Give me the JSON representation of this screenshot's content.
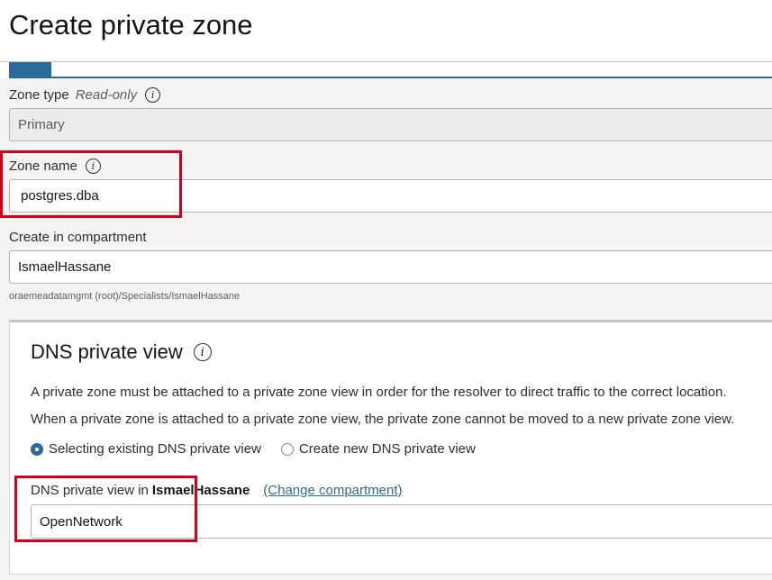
{
  "page": {
    "title": "Create private zone"
  },
  "zone_type": {
    "label": "Zone type",
    "readonly_tag": "Read-only",
    "value": "Primary"
  },
  "zone_name": {
    "label": "Zone name",
    "value": "postgres.dba"
  },
  "compartment": {
    "label": "Create in compartment",
    "value": "IsmaelHassane",
    "path": "oraemeadatamgmt (root)/Specialists/IsmaelHassane"
  },
  "dns_view": {
    "title": "DNS private view",
    "description_1": "A private zone must be attached to a private zone view in order for the resolver to direct traffic to the correct location.",
    "description_2": "When a private zone is attached to a private zone view, the private zone cannot be moved to a new private zone view.",
    "option_existing": "Selecting existing DNS private view",
    "option_new": "Create new DNS private view",
    "selected_option": "existing",
    "field_label_prefix": "DNS private view in",
    "field_label_compartment": "IsmaelHassane",
    "change_compartment_link": "(Change compartment)",
    "value": "OpenNetwork"
  },
  "colors": {
    "accent": "#2c6a9b",
    "highlight": "#d0021b",
    "background": "#f5f4f2"
  }
}
